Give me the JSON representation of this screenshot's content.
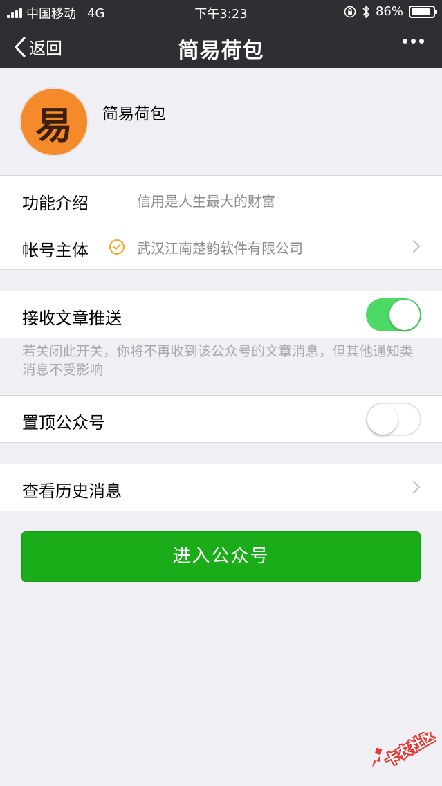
{
  "status_bar": {
    "carrier": "中国移动",
    "network": "4G",
    "time": "下午3:23",
    "battery": "86%",
    "battery_level": 0.86,
    "icons": [
      "signal-icon",
      "orientation-lock-icon",
      "bluetooth-icon",
      "battery-icon"
    ]
  },
  "nav": {
    "back_label": "返回",
    "title": "简易荷包",
    "more_icon": "more-icon"
  },
  "profile": {
    "avatar_glyph": "易",
    "name": "简易荷包"
  },
  "info": {
    "intro_label": "功能介绍",
    "intro_value": "信用是人生最大的财富",
    "account_label": "帐号主体",
    "account_value": "武汉江南楚韵软件有限公司"
  },
  "push": {
    "label": "接收文章推送",
    "enabled": true,
    "hint": "若关闭此开关，你将不再收到该公众号的文章消息，但其他通知类消息不受影响"
  },
  "pin": {
    "label": "置顶公众号",
    "enabled": false
  },
  "history": {
    "label": "查看历史消息"
  },
  "enter_button": "进入公众号",
  "watermark": "卡农社区",
  "colors": {
    "bar_bg": "#2f2f33",
    "page_bg": "#efeff4",
    "toggle_on": "#4cd964",
    "primary_button": "#1aad19",
    "avatar_bg": "#f58a2b",
    "verify": "#f5a623",
    "watermark": "#e53935"
  }
}
